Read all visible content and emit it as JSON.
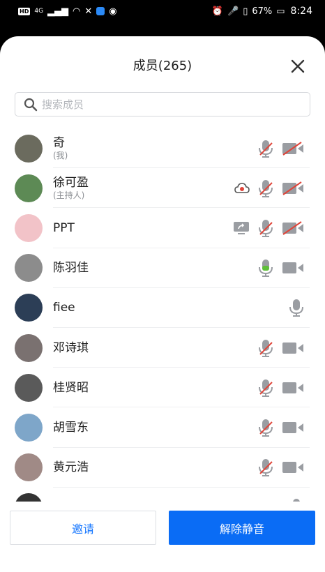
{
  "status_bar": {
    "left_chip": "HD",
    "net": "4G",
    "battery": "67%",
    "time": "8:24"
  },
  "header": {
    "title": "成员(265)"
  },
  "search": {
    "placeholder": "搜索成员"
  },
  "members": [
    {
      "name": "奇",
      "sub": "(我)",
      "avatar_color": "#6b6b5e",
      "icons": [
        "mic-muted",
        "video-off"
      ]
    },
    {
      "name": "徐可盈",
      "sub": "(主持人)",
      "avatar_color": "#5d8a55",
      "icons": [
        "cloud-record",
        "mic-muted",
        "video-off"
      ]
    },
    {
      "name": "PPT",
      "sub": "",
      "avatar_color": "#f2c3c8",
      "icons": [
        "screen-share",
        "mic-muted",
        "video-off"
      ]
    },
    {
      "name": "陈羽佳",
      "sub": "",
      "avatar_color": "#8c8c8c",
      "icons": [
        "mic-active",
        "video-on"
      ]
    },
    {
      "name": "fiee",
      "sub": "",
      "avatar_color": "#2c3e56",
      "icons": [
        "mic"
      ]
    },
    {
      "name": "邓诗琪",
      "sub": "",
      "avatar_color": "#7a7170",
      "icons": [
        "mic-muted-red",
        "video-on"
      ]
    },
    {
      "name": "桂贤昭",
      "sub": "",
      "avatar_color": "#5a5a5a",
      "icons": [
        "mic-muted-red",
        "video-on"
      ]
    },
    {
      "name": "胡雪东",
      "sub": "",
      "avatar_color": "#7ea6c9",
      "icons": [
        "mic-muted-red",
        "video-on"
      ]
    },
    {
      "name": "黄元浩",
      "sub": "",
      "avatar_color": "#a08a86",
      "icons": [
        "mic-muted-red",
        "video-on"
      ]
    },
    {
      "name": "",
      "sub": "",
      "avatar_color": "#333333",
      "icons": [
        "mic"
      ]
    }
  ],
  "footer": {
    "invite_label": "邀请",
    "unmute_label": "解除静音"
  },
  "colors": {
    "accent": "#0a6cf5",
    "mic_active": "#5fbf3a",
    "muted_slash": "#e0453a",
    "icon_grey": "#9a9da2"
  }
}
